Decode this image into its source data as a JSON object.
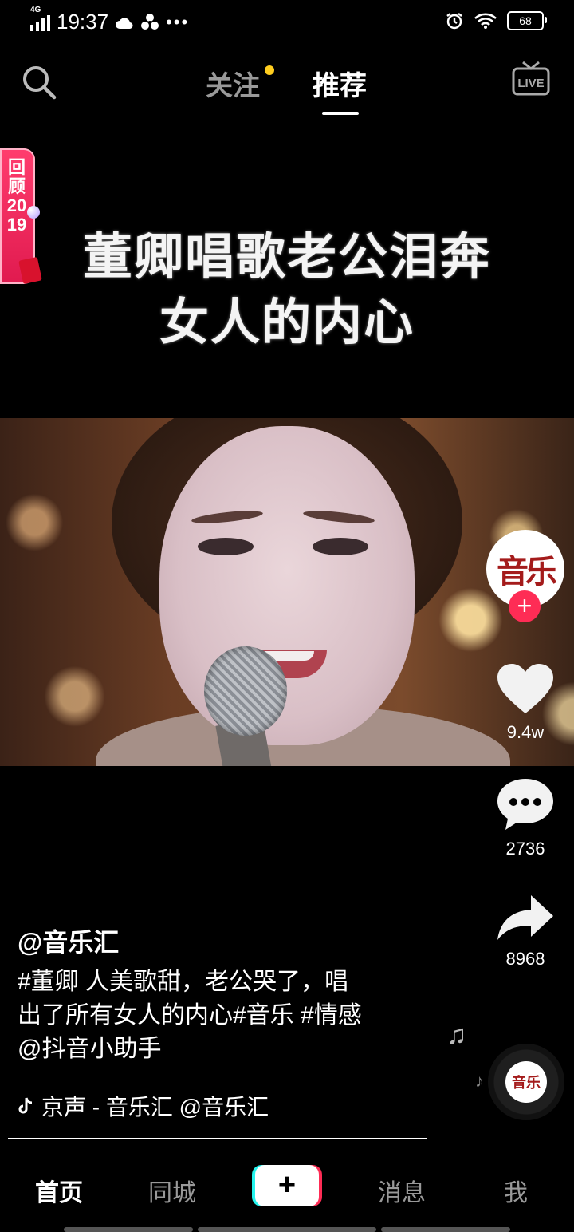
{
  "status_bar": {
    "network": "4G",
    "time": "19:37",
    "battery": "68"
  },
  "top_nav": {
    "tabs": [
      {
        "label": "关注",
        "active": false,
        "has_dot": true
      },
      {
        "label": "推荐",
        "active": true
      }
    ],
    "live_label": "LIVE"
  },
  "badge": {
    "text": "回顾2019"
  },
  "video": {
    "caption_line1": "董卿唱歌老公泪奔",
    "caption_line2": "女人的内心"
  },
  "actions": {
    "avatar_text": "音乐",
    "follow_symbol": "+",
    "likes": "9.4w",
    "comments": "2736",
    "shares": "8968",
    "disc_text": "音乐"
  },
  "post": {
    "author": "@音乐汇",
    "description_line1": "#董卿 人美歌甜，老公哭了，唱",
    "description_line2": "出了所有女人的内心#音乐 #情感",
    "description_line3": "@抖音小助手",
    "music": "京声 - 音乐汇    @音乐汇"
  },
  "bottom_nav": {
    "items": [
      "首页",
      "同城",
      "+",
      "消息",
      "我"
    ],
    "active": "首页"
  },
  "colors": {
    "accent": "#fe2c55",
    "cyan": "#25f4ee",
    "notify_dot": "#ffcd1f"
  }
}
